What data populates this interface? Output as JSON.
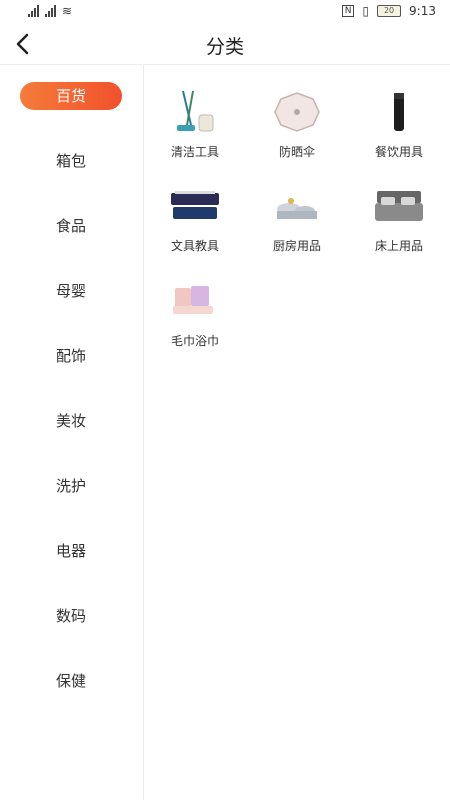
{
  "status": {
    "left_glyphs": "4G 4G",
    "right_nfc": "N",
    "battery": "20",
    "time": "9:13"
  },
  "header": {
    "title": "分类"
  },
  "sidebar": {
    "items": [
      {
        "label": "百货",
        "active": true
      },
      {
        "label": "箱包"
      },
      {
        "label": "食品"
      },
      {
        "label": "母婴"
      },
      {
        "label": "配饰"
      },
      {
        "label": "美妆"
      },
      {
        "label": "洗护"
      },
      {
        "label": "电器"
      },
      {
        "label": "数码"
      },
      {
        "label": "保健"
      }
    ]
  },
  "grid": {
    "items": [
      {
        "label": "清洁工具",
        "icon": "mop-icon"
      },
      {
        "label": "防晒伞",
        "icon": "umbrella-icon"
      },
      {
        "label": "餐饮用具",
        "icon": "thermos-icon"
      },
      {
        "label": "文具教具",
        "icon": "pencil-case-icon"
      },
      {
        "label": "厨房用品",
        "icon": "cookware-icon"
      },
      {
        "label": "床上用品",
        "icon": "bedding-icon"
      },
      {
        "label": "毛巾浴巾",
        "icon": "towel-icon"
      }
    ]
  }
}
